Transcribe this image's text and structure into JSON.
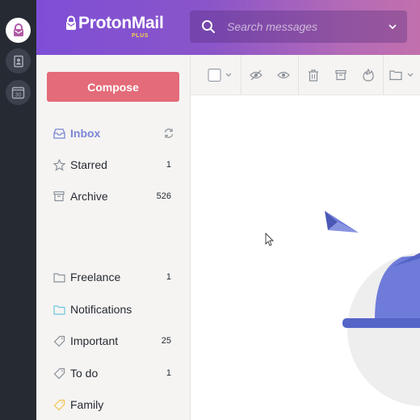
{
  "app": {
    "name": "ProtonMail",
    "plan_badge": "PLUS"
  },
  "search": {
    "placeholder": "Search messages"
  },
  "compose": {
    "label": "Compose"
  },
  "rail": {
    "items": [
      "mail-icon",
      "contacts-icon",
      "calendar-icon"
    ],
    "calendar_day": "30"
  },
  "sidebar": {
    "system": [
      {
        "label": "Inbox",
        "icon": "inbox-icon",
        "active": true,
        "refresh": true
      },
      {
        "label": "Starred",
        "icon": "star-icon",
        "count": "1"
      },
      {
        "label": "Archive",
        "icon": "archive-icon",
        "count": "526"
      }
    ],
    "folders": [
      {
        "label": "Freelance",
        "icon": "folder-icon",
        "count": "1",
        "color": "#8a8f99"
      },
      {
        "label": "Notifications",
        "icon": "folder-icon",
        "count": "",
        "color": "#6cc6e0"
      },
      {
        "label": "Important",
        "icon": "tag-icon",
        "count": "25",
        "color": "#8a8f99"
      },
      {
        "label": "To do",
        "icon": "tag-icon",
        "count": "1",
        "color": "#8a8f99"
      },
      {
        "label": "Family",
        "icon": "tag-icon",
        "count": "",
        "color": "#f1c24e"
      }
    ]
  },
  "toolbar": [
    "select-all-checkbox",
    "mark-unread-icon",
    "mark-read-icon",
    "trash-icon",
    "archive-icon",
    "spam-icon",
    "move-to-folder-icon"
  ],
  "colors": {
    "accent": "#7a86d6",
    "compose": "#e46b79",
    "rail": "#262a33",
    "header_start": "#7e4fd6",
    "header_end": "#c270ad"
  }
}
